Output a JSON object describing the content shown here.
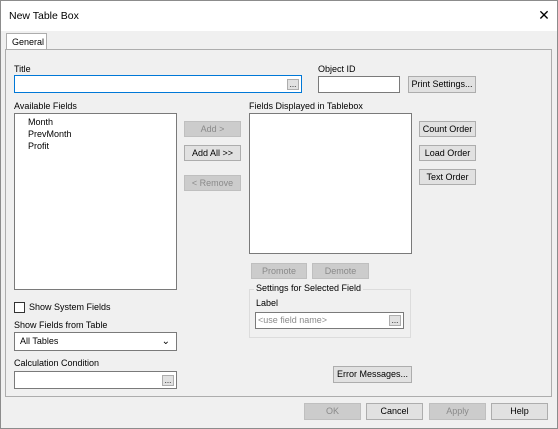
{
  "window": {
    "title": "New Table Box",
    "close_glyph": "✕"
  },
  "tabs": [
    {
      "label": "General",
      "active": true
    }
  ],
  "title_field": {
    "label": "Title",
    "value": "",
    "browse_label": "..."
  },
  "object_id": {
    "label": "Object ID",
    "value": ""
  },
  "print_settings_label": "Print Settings...",
  "available_fields": {
    "label": "Available Fields",
    "items": [
      "Month",
      "PrevMonth",
      "Profit"
    ]
  },
  "transfer_buttons": {
    "add": "Add >",
    "add_all": "Add All >>",
    "remove": "< Remove"
  },
  "displayed_fields": {
    "label": "Fields Displayed in Tablebox",
    "items": []
  },
  "order_buttons": {
    "count": "Count Order",
    "load": "Load Order",
    "text": "Text Order"
  },
  "promote_label": "Promote",
  "demote_label": "Demote",
  "selected_field_settings": {
    "legend": "Settings for Selected Field",
    "label_caption": "Label",
    "placeholder": "<use field name>",
    "browse_label": "..."
  },
  "show_system_fields": {
    "label": "Show System Fields",
    "checked": false
  },
  "show_fields_from_table": {
    "label": "Show Fields from Table",
    "selected": "All Tables"
  },
  "calculation_condition": {
    "label": "Calculation Condition",
    "value": "",
    "browse_label": "..."
  },
  "error_messages_label": "Error Messages...",
  "footer": {
    "ok": "OK",
    "cancel": "Cancel",
    "apply": "Apply",
    "help": "Help"
  },
  "colors": {
    "focus_border": "#0078d7",
    "disabled_text": "#8a8a8a",
    "dialog_bg": "#f0f0f0"
  }
}
